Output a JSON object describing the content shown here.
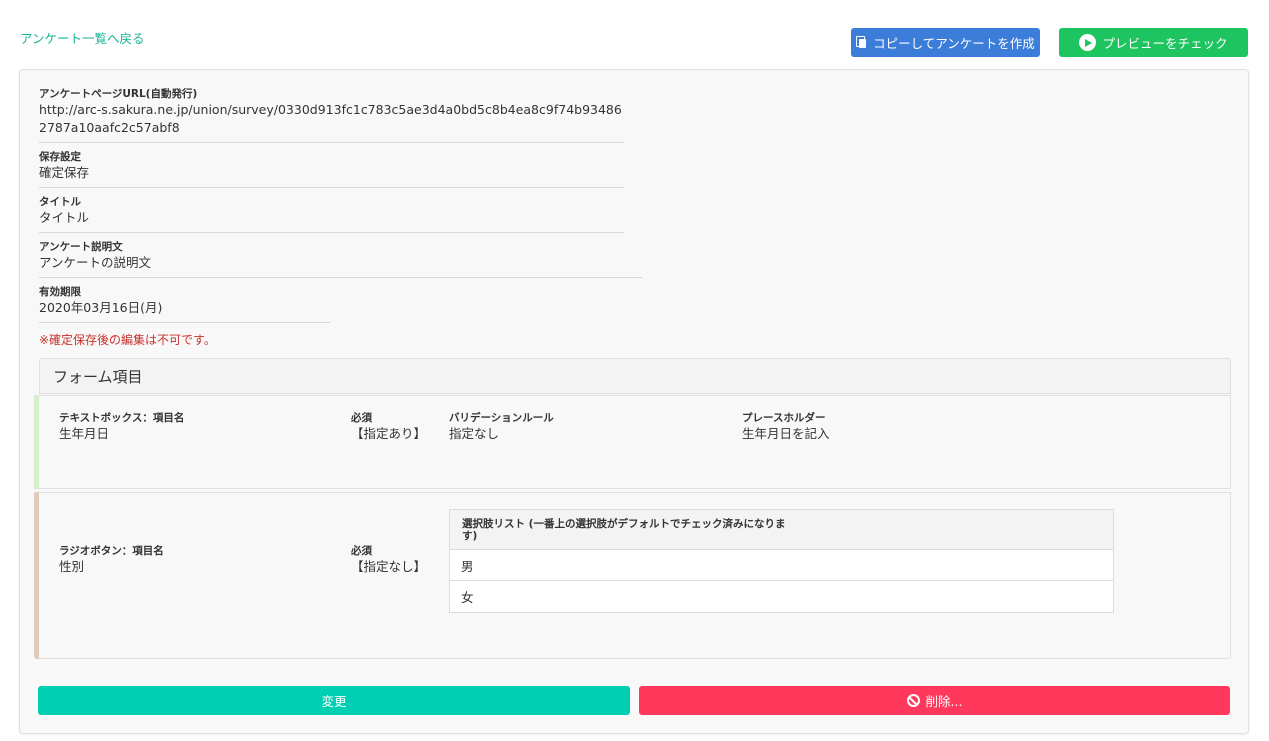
{
  "nav": {
    "back_label": "アンケート一覧へ戻る"
  },
  "toolbar": {
    "copy_label": "コピーしてアンケートを作成",
    "preview_label": "プレビューをチェック"
  },
  "details": {
    "url_label": "アンケートページURL(自動発行)",
    "url_value": "http://arc-s.sakura.ne.jp/union/survey/0330d913fc1c783c5ae3d4a0bd5c8b4ea8c9f74b934862787a10aafc2c57abf8",
    "save_label": "保存設定",
    "save_value": "確定保存",
    "title_label": "タイトル",
    "title_value": "タイトル",
    "desc_label": "アンケート説明文",
    "desc_value": "アンケートの説明文",
    "expiry_label": "有効期限",
    "expiry_value": "2020年03月16日(月)",
    "warning": "※確定保存後の編集は不可です。"
  },
  "form": {
    "header": "フォーム項目",
    "items": [
      {
        "type_label": "テキストボックス：項目名",
        "name": "生年月日",
        "required_label": "必須",
        "required_value": "【指定あり】",
        "validation_label": "バリデーションルール",
        "validation_value": "指定なし",
        "placeholder_label": "プレースホルダー",
        "placeholder_value": "生年月日を記入"
      },
      {
        "type_label": "ラジオボタン：項目名",
        "name": "性別",
        "required_label": "必須",
        "required_value": "【指定なし】",
        "choices_header": "選択肢リスト (一番上の選択肢がデフォルトでチェック済みになります)",
        "choices": [
          "男",
          "女"
        ]
      }
    ]
  },
  "actions": {
    "change_label": "変更",
    "delete_label": "削除..."
  },
  "colors": {
    "link": "#1ab394",
    "copy_button": "#3b7dd8",
    "preview_button": "#1ec45f",
    "change_button": "#00cfb1",
    "delete_button": "#ff385c",
    "warning_text": "#c9302c",
    "accent_textbox": "#d7eecd",
    "accent_radio": "#e0cbbd"
  },
  "icons": {
    "copy": "copy-icon",
    "preview": "play-circle-icon",
    "delete": "ban-icon"
  }
}
